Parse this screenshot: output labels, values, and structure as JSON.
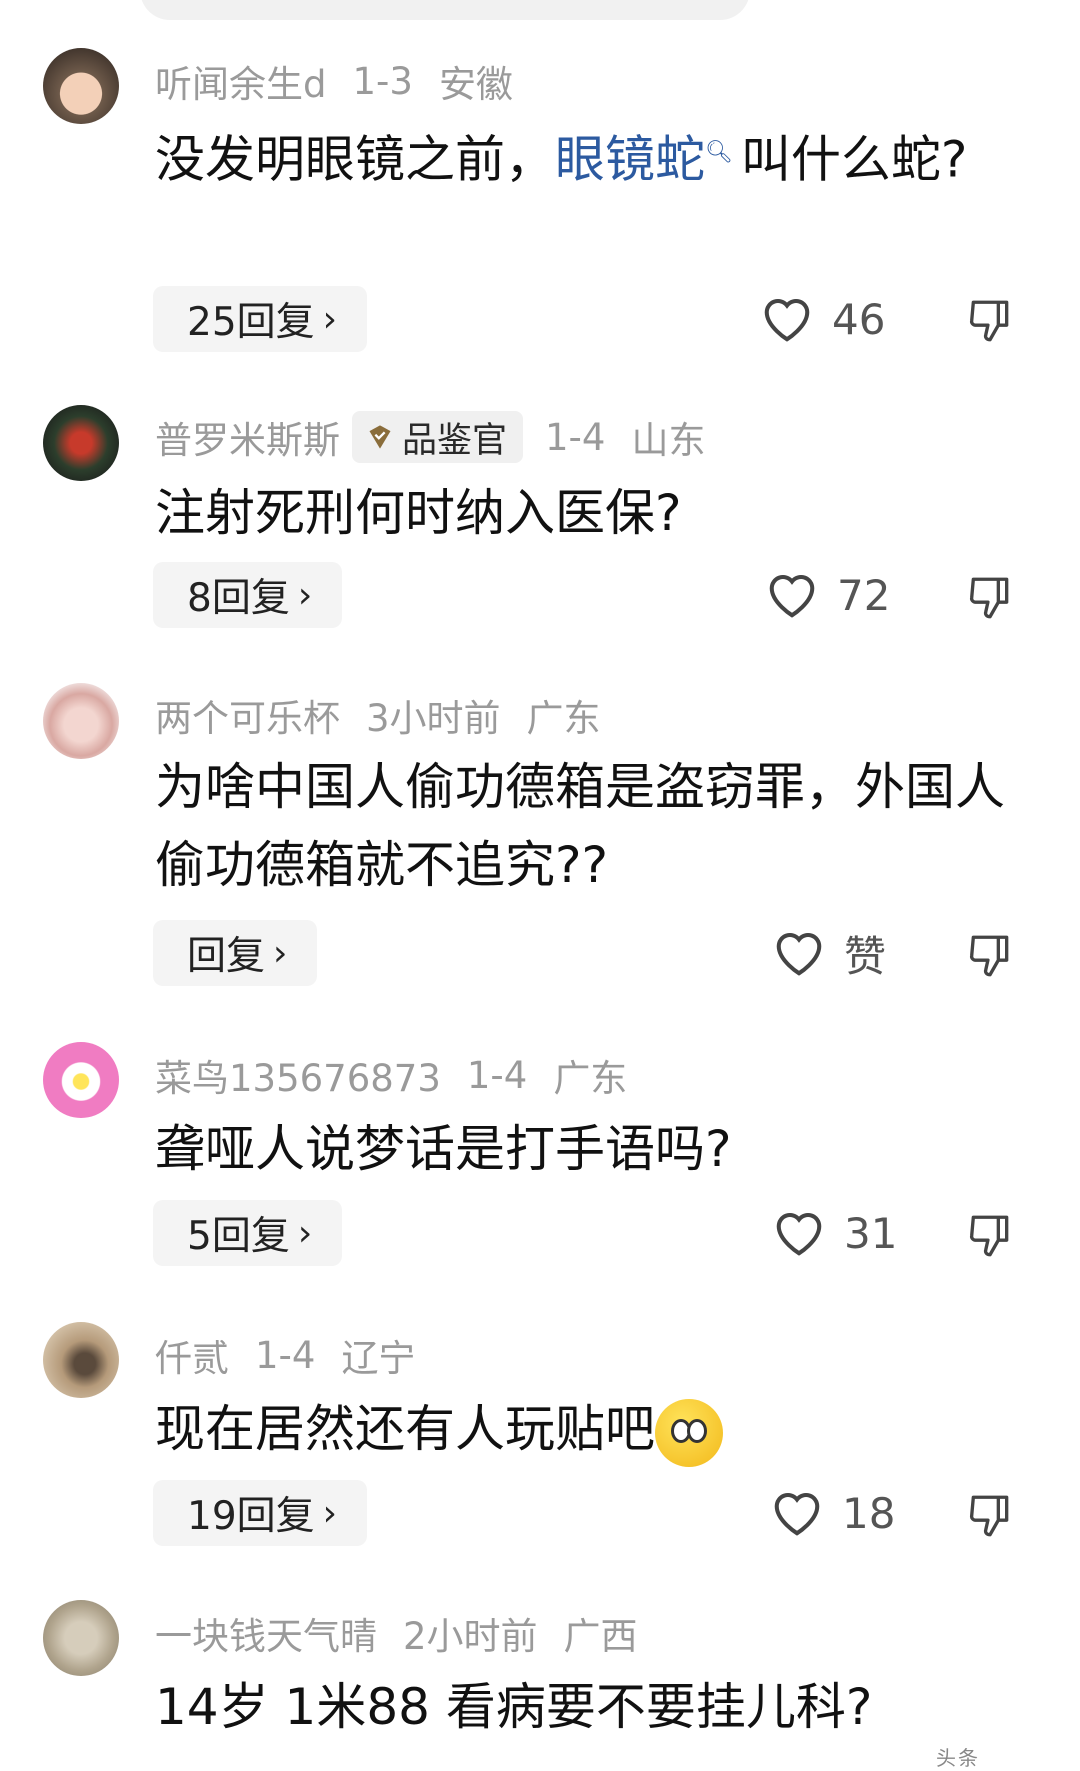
{
  "comments": [
    {
      "user": "听闻余生d",
      "date": "1-3",
      "region": "安徽",
      "text_before": "没发明眼镜之前，",
      "link": "眼镜蛇",
      "text_after": "叫什么蛇?",
      "replies": "25回复",
      "likes": "46"
    },
    {
      "user": "普罗米斯斯",
      "badge": "品鉴官",
      "date": "1-4",
      "region": "山东",
      "text": "注射死刑何时纳入医保?",
      "replies": "8回复",
      "likes": "72"
    },
    {
      "user": "两个可乐杯",
      "date": "3小时前",
      "region": "广东",
      "text": "为啥中国人偷功德箱是盗窃罪，外国人偷功德箱就不追究??",
      "replies": "回复",
      "likes": "赞"
    },
    {
      "user": "菜鸟135676873",
      "date": "1-4",
      "region": "广东",
      "text": "聋哑人说梦话是打手语吗?",
      "replies": "5回复",
      "likes": "31"
    },
    {
      "user": "仟贰",
      "date": "1-4",
      "region": "辽宁",
      "text": "现在居然还有人玩贴吧",
      "replies": "19回复",
      "likes": "18"
    },
    {
      "user": "一块钱天气晴",
      "date": "2小时前",
      "region": "广西",
      "text": "14岁 1米88 看病要不要挂儿科?"
    }
  ],
  "watermark": "头条",
  "icons": {
    "like": "heart-outline-icon",
    "dislike": "thumbs-down-icon",
    "chevron": "chevron-right-icon",
    "search": "search-icon",
    "badge": "shield-badge-icon",
    "emoji": "shocked-face-emoji"
  },
  "colors": {
    "link": "#2c5aa0",
    "meta": "#9a9a9a",
    "reply_bg": "#f4f4f4"
  }
}
